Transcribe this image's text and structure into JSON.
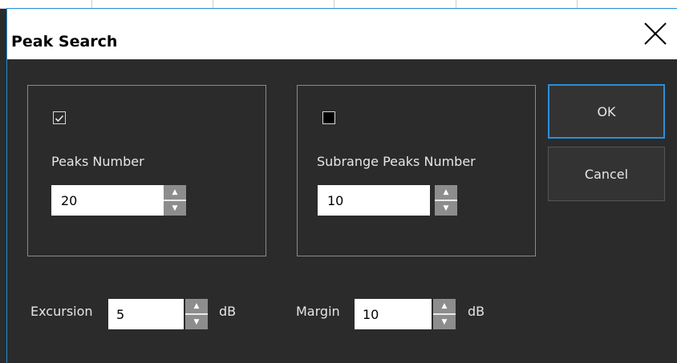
{
  "dialog": {
    "title": "Peak Search"
  },
  "peaks_group": {
    "enabled": true,
    "label": "Peaks Number",
    "value": "20"
  },
  "subrange_group": {
    "enabled": false,
    "label": "Subrange Peaks Number",
    "value": "10"
  },
  "excursion": {
    "label": "Excursion",
    "value": "5",
    "unit": "dB"
  },
  "margin": {
    "label": "Margin",
    "value": "10",
    "unit": "dB"
  },
  "buttons": {
    "ok": "OK",
    "cancel": "Cancel"
  },
  "colors": {
    "background": "#2b2b2b",
    "accent": "#2c8fd8",
    "text": "#e6e6e6"
  },
  "icons": {
    "close": "close-icon",
    "spin_up": "arrow-up-icon",
    "spin_down": "arrow-down-icon"
  }
}
